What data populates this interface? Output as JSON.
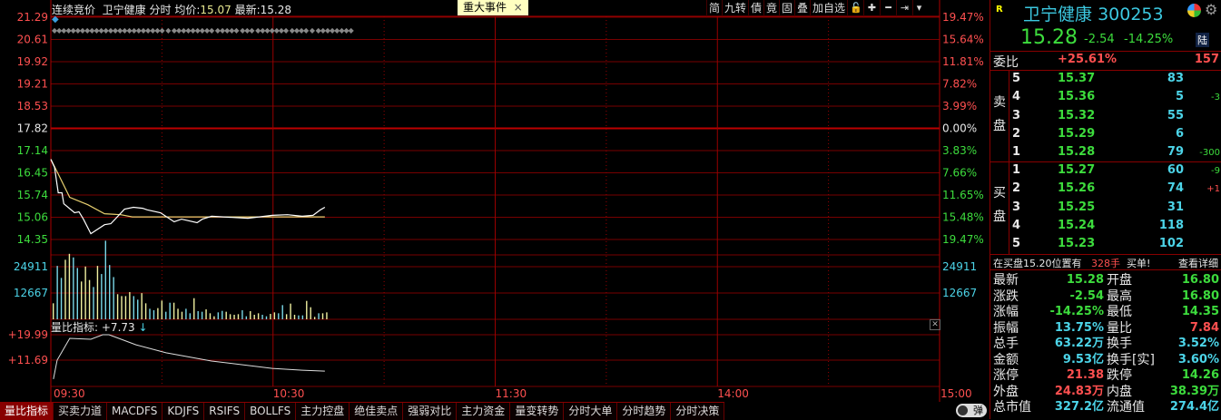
{
  "header": {
    "mode": "连续竞价",
    "name": "卫宁健康",
    "view": "分时",
    "avg_label": "均价:",
    "avg": "15.07",
    "last_label": "最新:",
    "last": "15.28",
    "event_button": "重大事件",
    "event_close": "×"
  },
  "toolbar": [
    "简",
    "九转",
    "債",
    "竟",
    "固",
    "叠",
    "加自选"
  ],
  "toolbar_icons": [
    "lock-icon",
    "plus-icon",
    "minus-icon",
    "skip-end-icon",
    "dropdown-icon"
  ],
  "price_axis": {
    "left": [
      "21.29",
      "20.61",
      "19.92",
      "19.21",
      "18.53",
      "17.82",
      "17.14",
      "16.45",
      "15.74",
      "15.06",
      "14.35"
    ],
    "right": [
      "19.47%",
      "15.64%",
      "11.81%",
      "7.82%",
      "3.99%",
      "0.00%",
      "3.83%",
      "7.66%",
      "11.65%",
      "15.48%",
      "19.47%"
    ],
    "prev_close": 17.82,
    "step": 0.69
  },
  "volume_axis": [
    "24911",
    "12667"
  ],
  "indicator": {
    "title": "量比指标:",
    "value": "+7.73",
    "axis": [
      "+19.99",
      "+11.69"
    ],
    "close": "✕"
  },
  "time_axis": [
    "09:30",
    "10:30",
    "11:30",
    "14:00",
    "15:00"
  ],
  "tabs": [
    "量比指标",
    "买卖力道",
    "MACDFS",
    "KDJFS",
    "RSIFS",
    "BOLLFS",
    "主力控盘",
    "绝佳卖点",
    "强弱对比",
    "主力资金",
    "量变转势",
    "分时大单",
    "分时趋势",
    "分时决策"
  ],
  "toggle_label": "弹",
  "chart_data": {
    "type": "line",
    "price": [
      [
        0,
        16.86
      ],
      [
        1,
        16.61
      ],
      [
        2,
        15.82
      ],
      [
        3,
        15.82
      ],
      [
        3.5,
        15.48
      ],
      [
        6.4,
        15.2
      ],
      [
        7.6,
        15.23
      ],
      [
        8.8,
        15.0
      ],
      [
        10.8,
        14.55
      ],
      [
        14.5,
        14.83
      ],
      [
        16.2,
        14.86
      ],
      [
        19.9,
        15.31
      ],
      [
        22.3,
        15.37
      ],
      [
        24.8,
        15.34
      ],
      [
        26,
        15.29
      ],
      [
        29.6,
        15.2
      ],
      [
        33.3,
        14.92
      ],
      [
        35.3,
        15.0
      ],
      [
        39.5,
        14.89
      ],
      [
        40.9,
        15.0
      ],
      [
        43.4,
        15.09
      ],
      [
        53.2,
        15.03
      ],
      [
        59.8,
        15.12
      ],
      [
        63.9,
        15.14
      ],
      [
        67.9,
        15.09
      ],
      [
        70.8,
        15.12
      ],
      [
        72.8,
        15.29
      ],
      [
        74,
        15.37
      ]
    ],
    "avg": [
      [
        0,
        16.86
      ],
      [
        1.7,
        16.47
      ],
      [
        5.1,
        15.68
      ],
      [
        10,
        15.45
      ],
      [
        14.5,
        15.17
      ],
      [
        18.9,
        15.14
      ],
      [
        22,
        15.07
      ],
      [
        74,
        15.07
      ]
    ],
    "volume": [
      7580,
      25300,
      19600,
      28200,
      31000,
      29300,
      24300,
      17900,
      25000,
      18600,
      15300,
      25300,
      21450,
      37200,
      25700,
      20000,
      11900,
      11000,
      11000,
      12900,
      11000,
      9300,
      12400,
      7580,
      5000,
      4290,
      5300,
      8870,
      3580,
      7860,
      7860,
      5000,
      3580,
      5000,
      2860,
      10000,
      3860,
      3580,
      4720,
      2860,
      1430,
      3290,
      4000,
      3580,
      2430,
      2150,
      2430,
      4290,
      1430,
      3860,
      2150,
      2860,
      2150,
      1430,
      2570,
      3290,
      2860,
      6720,
      2430,
      7440,
      2150,
      1860,
      1860,
      8720,
      5720,
      1140,
      2860,
      2860,
      3290
    ],
    "volume_dir": "duudduuddduduuuudddduudduudduuddduuduuddduudddduuddduudduuddduudddud",
    "volume_max": 24911,
    "indicator": [
      [
        0.7,
        5.5
      ],
      [
        1.7,
        11.7
      ],
      [
        5.1,
        18.8
      ],
      [
        10.8,
        18.5
      ],
      [
        14,
        20
      ],
      [
        15.7,
        20
      ],
      [
        23,
        16.7
      ],
      [
        31.1,
        14.1
      ],
      [
        43.4,
        11.4
      ],
      [
        59.8,
        9.0
      ],
      [
        67.9,
        8.4
      ],
      [
        74,
        8.1
      ]
    ],
    "xrange_minutes": [
      0,
      240
    ]
  },
  "quote": {
    "r_badge": "R",
    "name": "卫宁健康",
    "code": "300253",
    "price": "15.28",
    "change": "-2.54",
    "pct": "-14.25%",
    "lu_badge": "陆",
    "weibi_label": "委比",
    "weibi": "+25.61%",
    "weicha": "157",
    "sell_label": [
      "卖",
      "盘"
    ],
    "buy_label": [
      "买",
      "盘"
    ],
    "sell": [
      {
        "lvl": "5",
        "p": "15.37",
        "v": "83",
        "d": ""
      },
      {
        "lvl": "4",
        "p": "15.36",
        "v": "5",
        "d": "-3"
      },
      {
        "lvl": "3",
        "p": "15.32",
        "v": "55",
        "d": ""
      },
      {
        "lvl": "2",
        "p": "15.29",
        "v": "6",
        "d": ""
      },
      {
        "lvl": "1",
        "p": "15.28",
        "v": "79",
        "d": "-300"
      }
    ],
    "buy": [
      {
        "lvl": "1",
        "p": "15.27",
        "v": "60",
        "d": "-9"
      },
      {
        "lvl": "2",
        "p": "15.26",
        "v": "74",
        "d": "+1"
      },
      {
        "lvl": "3",
        "p": "15.25",
        "v": "31",
        "d": ""
      },
      {
        "lvl": "4",
        "p": "15.24",
        "v": "118",
        "d": ""
      },
      {
        "lvl": "5",
        "p": "15.23",
        "v": "102",
        "d": ""
      }
    ],
    "notice": "在买盘15.20位置有",
    "notice_qty": "328手",
    "notice_tail": "买单!",
    "notice_link": "查看详细",
    "stats": [
      [
        "最新",
        "15.28",
        "grn",
        "开盘",
        "16.80",
        "grn"
      ],
      [
        "涨跌",
        "-2.54",
        "grn",
        "最高",
        "16.80",
        "grn"
      ],
      [
        "涨幅",
        "-14.25%",
        "grn",
        "最低",
        "14.35",
        "grn"
      ],
      [
        "振幅",
        "13.75%",
        "cyn",
        "量比",
        "7.84",
        "red"
      ],
      [
        "总手",
        "63.22万",
        "cyn",
        "换手",
        "3.52%",
        "cyn"
      ],
      [
        "金额",
        "9.53亿",
        "cyn",
        "换手[实]",
        "3.60%",
        "cyn"
      ],
      [
        "涨停",
        "21.38",
        "red",
        "跌停",
        "14.26",
        "grn"
      ],
      [
        "外盘",
        "24.83万",
        "red",
        "内盘",
        "38.39万",
        "grn"
      ],
      [
        "总市值",
        "327.2亿",
        "cyn",
        "流通值",
        "274.4亿",
        "cyn"
      ]
    ]
  }
}
